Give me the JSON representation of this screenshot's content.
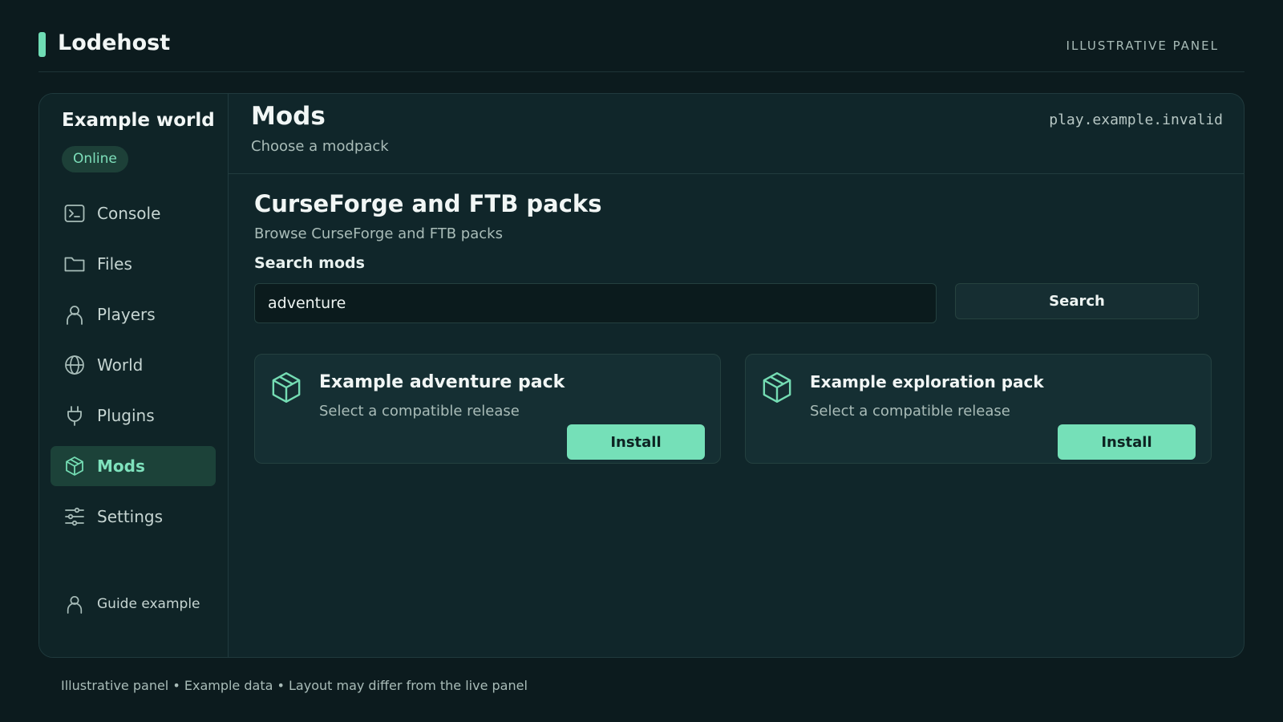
{
  "app": {
    "name": "Lodehost",
    "tag": "ILLUSTRATIVE PANEL"
  },
  "server": {
    "name": "Example world",
    "status": "Online",
    "address": "play.example.invalid"
  },
  "sidebar": {
    "items": [
      {
        "label": "Console",
        "icon": "console-icon"
      },
      {
        "label": "Files",
        "icon": "folder-icon"
      },
      {
        "label": "Players",
        "icon": "user-icon"
      },
      {
        "label": "World",
        "icon": "globe-icon"
      },
      {
        "label": "Plugins",
        "icon": "plug-icon"
      },
      {
        "label": "Mods",
        "icon": "cube-icon",
        "active": true
      },
      {
        "label": "Settings",
        "icon": "sliders-icon"
      }
    ],
    "user": {
      "label": "Guide example",
      "icon": "user-icon"
    }
  },
  "main": {
    "title": "Mods",
    "subtitle": "Choose a modpack",
    "section": {
      "title": "CurseForge and FTB packs",
      "description": "Browse CurseForge and FTB packs"
    },
    "search": {
      "label": "Search mods",
      "value": "adventure",
      "button_label": "Search"
    },
    "packs": [
      {
        "name": "Example adventure pack",
        "description": "Select a compatible release",
        "button_label": "Install",
        "icon": "cube-icon"
      },
      {
        "name": "Example exploration pack",
        "description": "Select a compatible release",
        "button_label": "Install",
        "icon": "cube-icon"
      }
    ]
  },
  "footer": {
    "note": "Illustrative panel • Example data • Layout may differ from the live panel"
  },
  "colors": {
    "accent": "#75e0b8",
    "background": "#0c1b1e",
    "panel": "#10262a"
  }
}
